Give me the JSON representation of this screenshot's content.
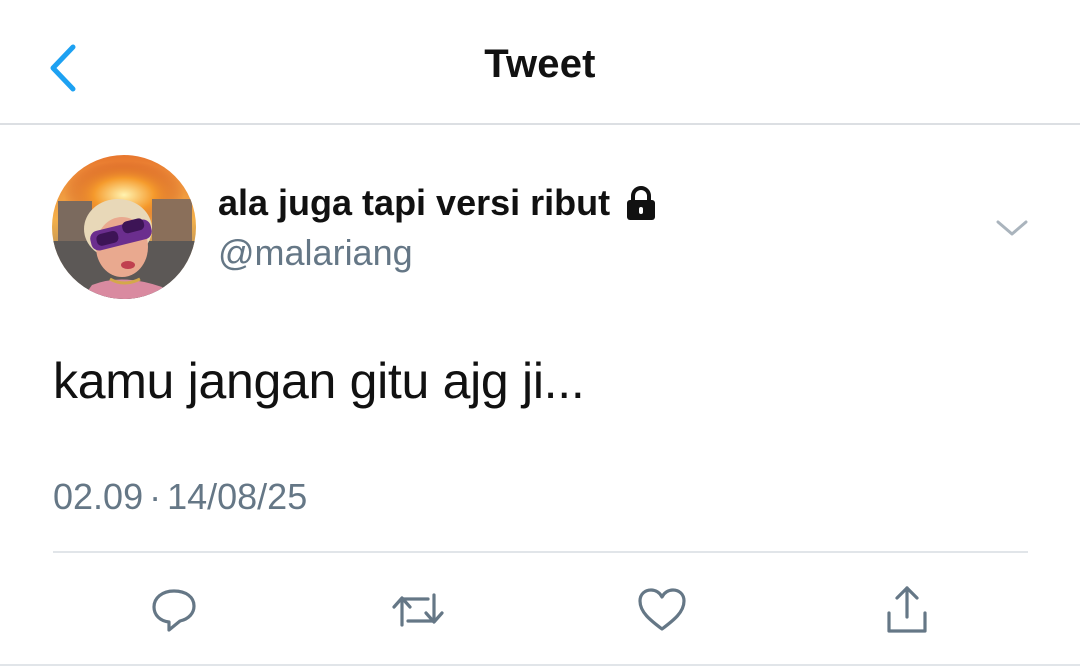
{
  "header": {
    "title": "Tweet",
    "back_icon": "chevron-left-icon",
    "accent_color": "#1da1f2"
  },
  "tweet": {
    "display_name": "ala juga tapi versi ribut",
    "username": "@malariang",
    "protected_icon": "lock-icon",
    "text": "kamu jangan gitu ajg ji...",
    "time": "02.09",
    "separator": "·",
    "date": "14/08/25",
    "menu_icon": "chevron-down-icon"
  },
  "actions": [
    {
      "name": "reply",
      "icon": "reply-icon"
    },
    {
      "name": "retweet",
      "icon": "retweet-icon"
    },
    {
      "name": "like",
      "icon": "heart-icon"
    },
    {
      "name": "share",
      "icon": "share-icon"
    }
  ],
  "colors": {
    "text_primary": "#111111",
    "text_secondary": "#657786",
    "divider": "#e1e5e9"
  }
}
